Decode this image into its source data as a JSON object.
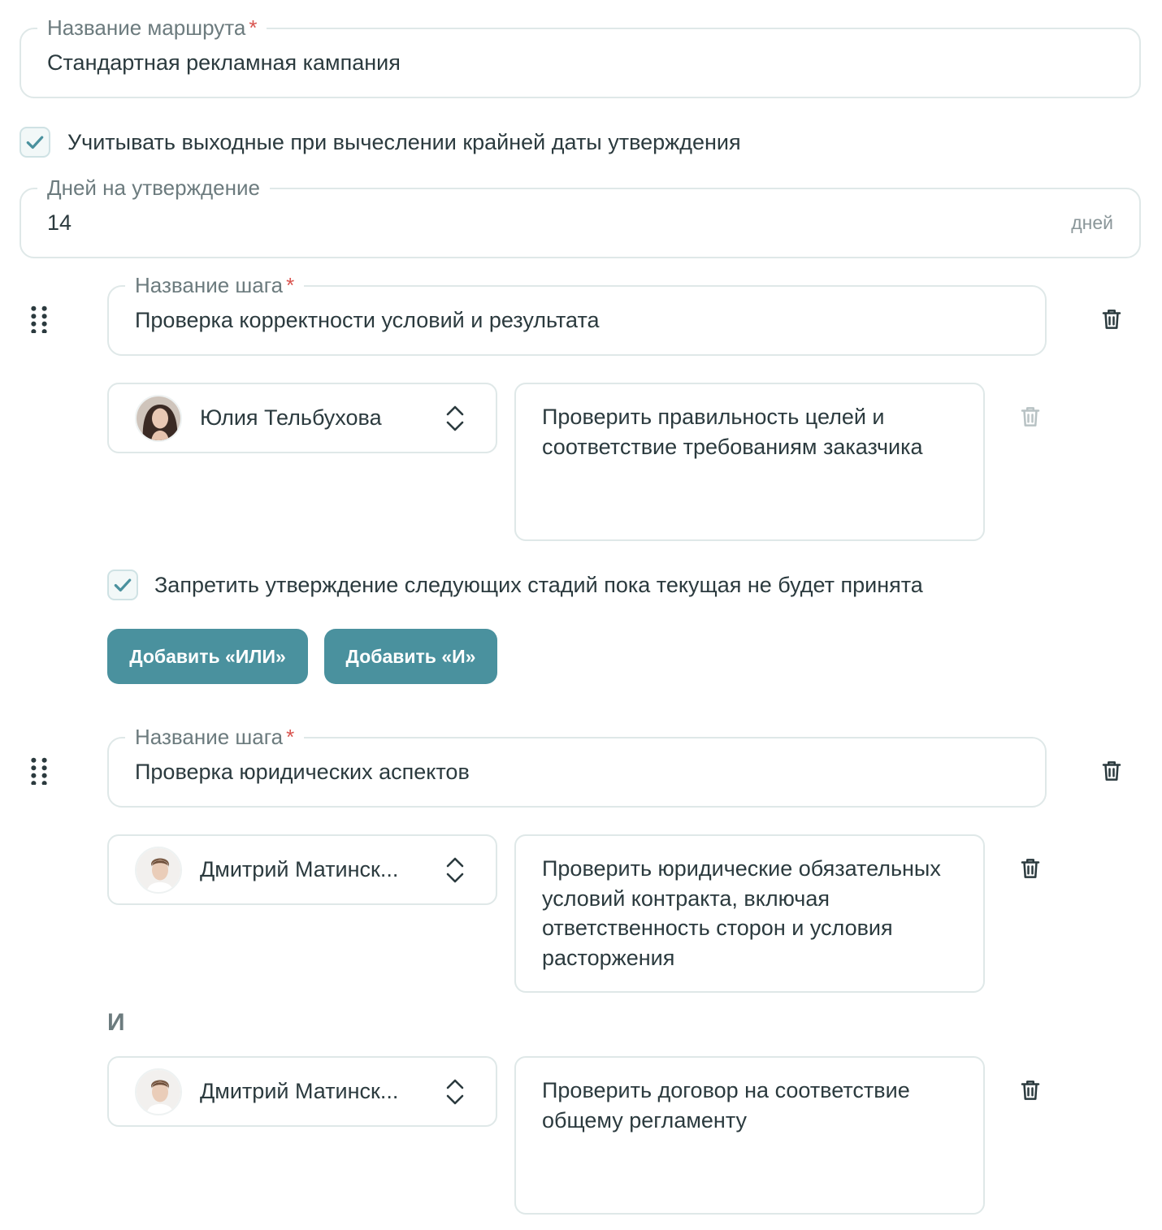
{
  "route": {
    "name_label": "Название маршрута",
    "name_value": "Стандартная рекламная кампания",
    "weekends_label": "Учитывать выходные при вычеслении крайней даты утверждения",
    "weekends_checked": true,
    "days_label": "Дней на утверждение",
    "days_value": "14",
    "days_suffix": "дней"
  },
  "steps": [
    {
      "name_label": "Название шага",
      "name_value": "Проверка корректности условий и результата",
      "approvers": [
        {
          "name": "Юлия Тельбухова",
          "comment": "Проверить правильность целей и соответствие требованиям заказчика",
          "delete_disabled": true
        }
      ],
      "block_label": "Запретить утверждение следующих стадий пока текущая не будет принята",
      "block_checked": true,
      "add_or_label": "Добавить «ИЛИ»",
      "add_and_label": "Добавить «И»"
    },
    {
      "name_label": "Название шага",
      "name_value": "Проверка юридических аспектов",
      "approvers": [
        {
          "name": "Дмитрий Матинск...",
          "comment": "Проверить юридические обязательных условий контракта, включая ответственность сторон и условия расторжения"
        },
        {
          "name": "Дмитрий Матинск...",
          "comment": "Проверить договор на соответствие общему регламенту"
        }
      ],
      "and_separator": "И"
    }
  ],
  "icons": {
    "drag": "drag-handle-icon",
    "trash": "trash-icon",
    "updown": "chevron-updown-icon",
    "check": "check-icon"
  },
  "colors": {
    "accent": "#4a919e",
    "required": "#d9544f",
    "border": "#dfe8e8",
    "text": "#2b3a3e",
    "muted": "#6c7b7e"
  }
}
